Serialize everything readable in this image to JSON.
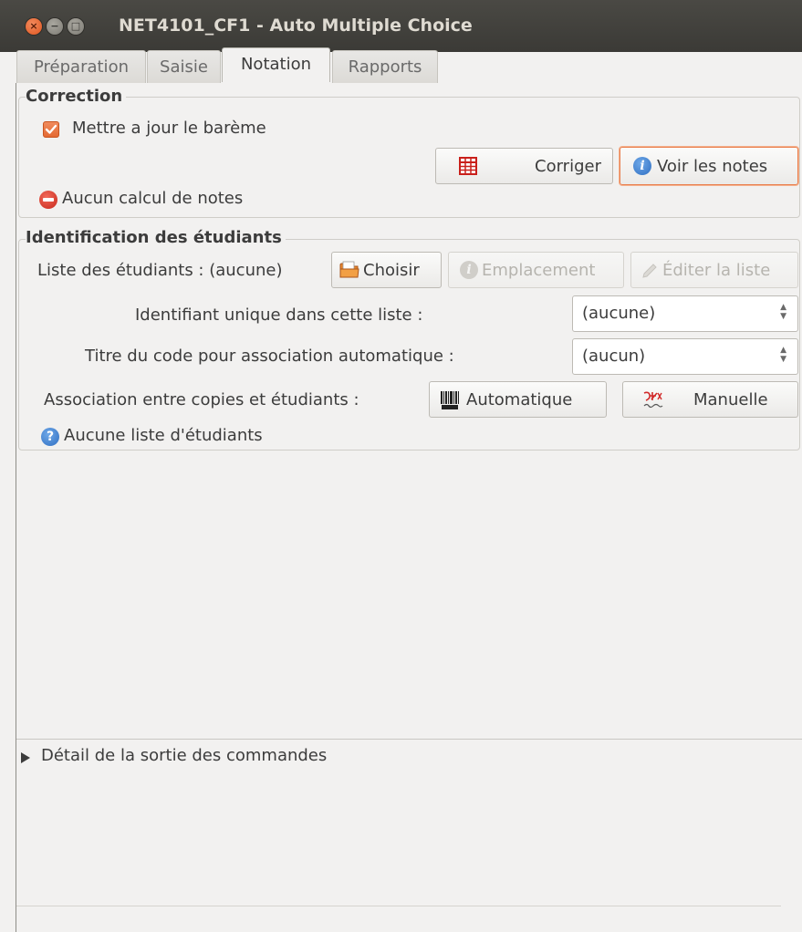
{
  "window": {
    "title": "NET4101_CF1 - Auto Multiple Choice",
    "buttons": {
      "close": "×",
      "minimize": "−",
      "maximize": "□"
    }
  },
  "tabs": [
    {
      "label": "Préparation",
      "active": false
    },
    {
      "label": "Saisie",
      "active": false
    },
    {
      "label": "Notation",
      "active": true
    },
    {
      "label": "Rapports",
      "active": false
    }
  ],
  "correction": {
    "frame_title": "Correction",
    "update_scale_label": "Mettre a jour le barème",
    "update_scale_checked": true,
    "correct_button": "Corriger",
    "view_notes_button": "Voir les notes",
    "status_text": "Aucun calcul de notes"
  },
  "identification": {
    "frame_title": "Identification des étudiants",
    "student_list_label": "Liste des étudiants : (aucune)",
    "choose_button": "Choisir",
    "location_button": "Emplacement",
    "edit_list_button": "Éditer la liste",
    "unique_id_label": "Identifiant unique dans cette liste :",
    "unique_id_value": "(aucune)",
    "code_title_label": "Titre du code pour association automatique :",
    "code_title_value": "(aucun)",
    "association_label": "Association entre copies et étudiants :",
    "automatic_button": "Automatique",
    "manual_button": "Manuelle",
    "status_text": "Aucune liste d'étudiants"
  },
  "output": {
    "expander_label": "Détail de la sortie des commandes"
  },
  "colors": {
    "accent": "#e97e4d",
    "titlebar": "#3b3a36",
    "background": "#f2f1f0"
  }
}
